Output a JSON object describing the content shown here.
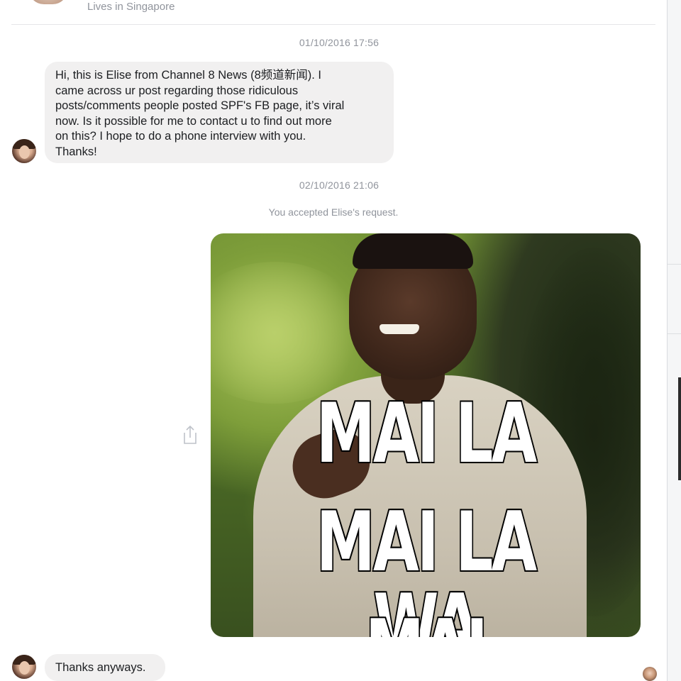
{
  "header": {
    "subtitle": "Lives in Singapore"
  },
  "thread": {
    "timestamp_1": "01/10/2016 17:56",
    "message_1_lines": [
      "Hi, this is Elise from Channel 8 News (8频道新闻). I",
      "came across ur post regarding those ridiculous",
      "posts/comments people posted SPF's FB page, it’s viral",
      "now. Is it possible for me to contact u  to find out more",
      "on this? I hope to do a phone interview with you.",
      "Thanks!"
    ],
    "timestamp_2": "02/10/2016 21:06",
    "system_notice": "You accepted Elise's request.",
    "meme": {
      "line1": "MAI LA",
      "line2": "MAI LA WA",
      "line3": "MAI"
    },
    "message_2": "Thanks anyways."
  },
  "icons": {
    "share": "share-icon",
    "sender_avatar": "avatar",
    "read_receipt": "read-receipt-avatar"
  }
}
